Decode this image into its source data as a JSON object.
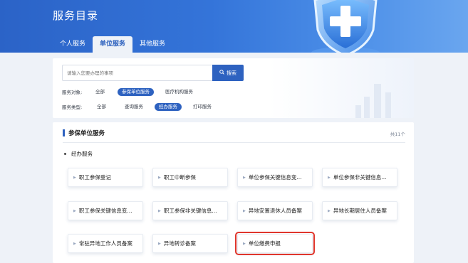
{
  "header": {
    "title": "服务目录",
    "tabs": [
      {
        "label": "个人服务",
        "active": false
      },
      {
        "label": "单位服务",
        "active": true
      },
      {
        "label": "其他服务",
        "active": false
      }
    ]
  },
  "search": {
    "placeholder": "请输入您要办理的事项",
    "button_label": "搜索"
  },
  "filters": {
    "target_label": "服务对象:",
    "target_options": [
      {
        "label": "全部",
        "active": false
      },
      {
        "label": "参保单位服务",
        "active": true
      },
      {
        "label": "医疗机构服务",
        "active": false
      }
    ],
    "type_label": "服务类型:",
    "type_options": [
      {
        "label": "全部",
        "active": false
      },
      {
        "label": "查询服务",
        "active": false
      },
      {
        "label": "经办服务",
        "active": true
      },
      {
        "label": "打印服务",
        "active": false
      }
    ]
  },
  "content": {
    "section_title": "参保单位服务",
    "count_text": "共11个",
    "subsection_title": "经办服务",
    "services": [
      {
        "label": "职工参保登记"
      },
      {
        "label": "职工中断参保"
      },
      {
        "label": "单位参保关键信息变..."
      },
      {
        "label": "单位参保非关键信息..."
      },
      {
        "label": "职工参保关键信息变..."
      },
      {
        "label": "职工参保非关键信息..."
      },
      {
        "label": "异地安置退休人员备案"
      },
      {
        "label": "异地长期居住人员备案"
      },
      {
        "label": "常驻异地工作人员备案"
      },
      {
        "label": "异地转诊备案"
      },
      {
        "label": "单位缴费申报",
        "highlighted": true
      }
    ]
  },
  "colors": {
    "brand": "#2e62c0",
    "highlight_border": "#e0362c"
  }
}
